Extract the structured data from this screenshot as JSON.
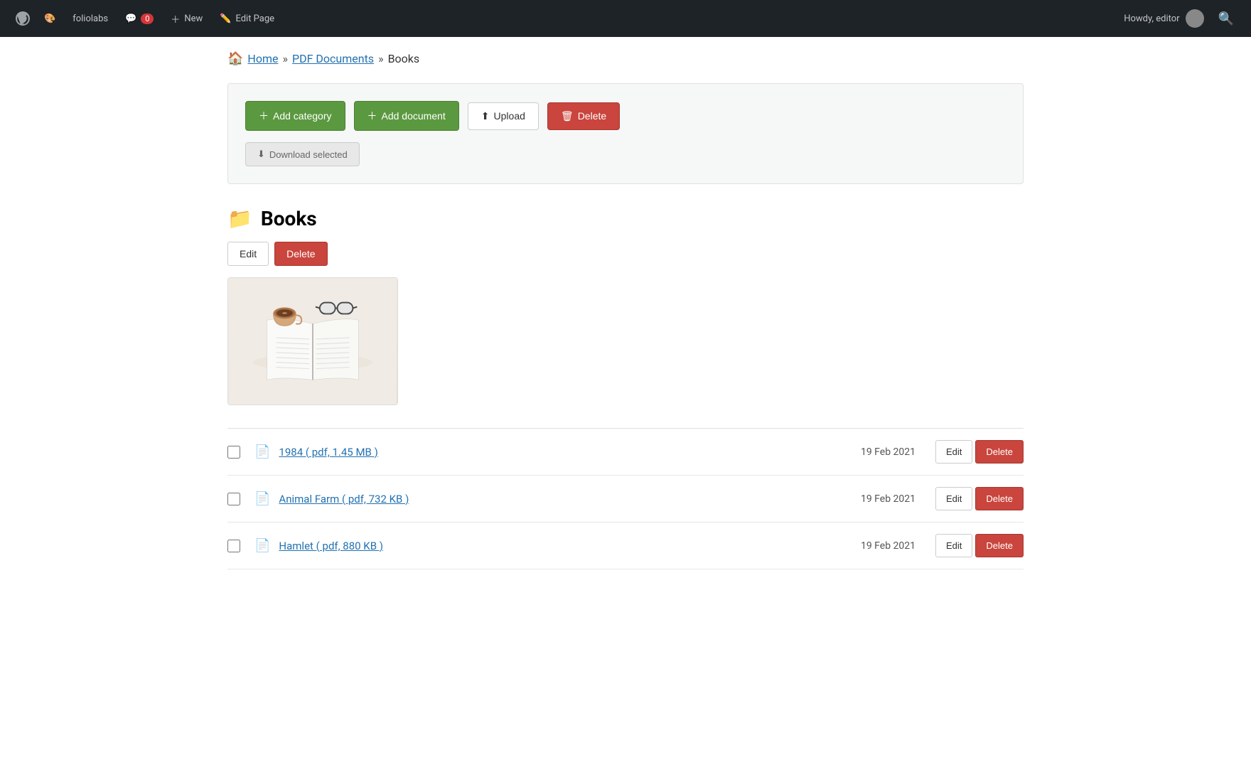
{
  "adminBar": {
    "siteName": "foliolabs",
    "commentCount": "0",
    "newLabel": "New",
    "editPageLabel": "Edit Page",
    "howdyText": "Howdy, editor"
  },
  "breadcrumb": {
    "homeLabel": "Home",
    "pdfDocsLabel": "PDF Documents",
    "currentLabel": "Books"
  },
  "toolbar": {
    "addCategoryLabel": "Add category",
    "addDocumentLabel": "Add document",
    "uploadLabel": "Upload",
    "deleteLabel": "Delete",
    "downloadSelectedLabel": "Download selected"
  },
  "category": {
    "title": "Books",
    "editLabel": "Edit",
    "deleteLabel": "Delete"
  },
  "documents": [
    {
      "name": "1984 ( pdf, 1.45 MB )",
      "date": "19 Feb 2021",
      "editLabel": "Edit",
      "deleteLabel": "Delete"
    },
    {
      "name": "Animal Farm ( pdf, 732 KB )",
      "date": "19 Feb 2021",
      "editLabel": "Edit",
      "deleteLabel": "Delete"
    },
    {
      "name": "Hamlet ( pdf, 880 KB )",
      "date": "19 Feb 2021",
      "editLabel": "Edit",
      "deleteLabel": "Delete"
    }
  ]
}
